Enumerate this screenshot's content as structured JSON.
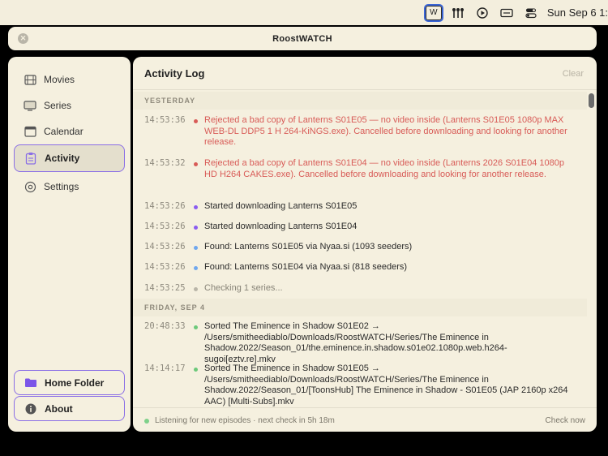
{
  "menubar": {
    "w_icon_label": "W",
    "date": "Sun Sep 6  1:"
  },
  "window": {
    "title": "RoostWATCH"
  },
  "sidebar": {
    "items": [
      {
        "label": "Movies",
        "icon": "film-icon"
      },
      {
        "label": "Series",
        "icon": "tv-icon"
      },
      {
        "label": "Calendar",
        "icon": "calendar-icon"
      },
      {
        "label": "Activity",
        "icon": "clipboard-icon",
        "active": true
      },
      {
        "label": "Settings",
        "icon": "gear-icon"
      }
    ],
    "home_folder_label": "Home Folder",
    "about_label": "About"
  },
  "main": {
    "title": "Activity Log",
    "clear_label": "Clear",
    "sections": [
      {
        "heading": "YESTERDAY",
        "entries": [
          {
            "time": "14:53:36",
            "status": "error",
            "color": "#d85b57",
            "text": "Rejected a bad copy of Lanterns S01E05 — no video inside (Lanterns S01E05 1080p MAX WEB-DL DDP5 1 H 264-KiNGS.exe). Cancelled before downloading and looking for another release."
          },
          {
            "time": "14:53:32",
            "status": "error",
            "color": "#d85b57",
            "text": "Rejected a bad copy of Lanterns S01E04 — no video inside (Lanterns 2026 S01E04 1080p HD H264 CAKES.exe). Cancelled before downloading and looking for another release."
          },
          {
            "time": "14:53:26",
            "status": "download",
            "color": "#8a5cf0",
            "text": "Started downloading Lanterns S01E05"
          },
          {
            "time": "14:53:26",
            "status": "download",
            "color": "#8a5cf0",
            "text": "Started downloading Lanterns S01E04"
          },
          {
            "time": "14:53:26",
            "status": "found",
            "color": "#6fa7ee",
            "text": "Found: Lanterns S01E05 via Nyaa.si (1093 seeders)"
          },
          {
            "time": "14:53:26",
            "status": "found",
            "color": "#6fa7ee",
            "text": "Found: Lanterns S01E04 via Nyaa.si (818 seeders)"
          },
          {
            "time": "14:53:25",
            "status": "info",
            "color": "#b9b5a8",
            "text": "Checking 1 series..."
          }
        ]
      },
      {
        "heading": "FRIDAY, SEP 4",
        "entries": [
          {
            "time": "20:48:33",
            "status": "success",
            "color": "#6cc97a",
            "text": "Sorted The Eminence in Shadow S01E02 → /Users/smitheediablo/Downloads/RoostWATCH/Series/The Eminence in Shadow.2022/Season_01/the.eminence.in.shadow.s01e02.1080p.web.h264-sugoi[eztv.re].mkv"
          },
          {
            "time": "14:14:17",
            "status": "success",
            "color": "#6cc97a",
            "text": "Sorted The Eminence in Shadow S01E05 → /Users/smitheediablo/Downloads/RoostWATCH/Series/The Eminence in Shadow.2022/Season_01/[ToonsHub] The Eminence in Shadow - S01E05 (JAP 2160p x264 AAC) [Multi-Subs].mkv"
          }
        ]
      }
    ]
  },
  "footer": {
    "status_text": "Listening for new episodes · next check in 5h 18m",
    "check_now_label": "Check now"
  }
}
